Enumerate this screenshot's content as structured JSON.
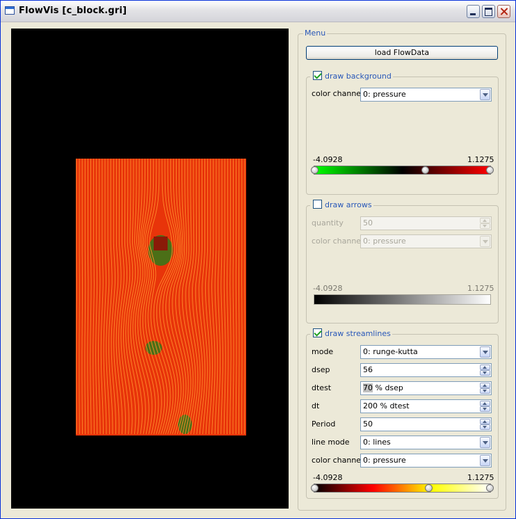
{
  "window": {
    "title": "FlowVis [c_block.gri]"
  },
  "menu": {
    "title": "Menu",
    "load_button": "load FlowData",
    "background": {
      "title": "draw background",
      "checked": true,
      "color_channel_label": "color channel",
      "color_channel_value": "0: pressure",
      "min": "-4.0928",
      "max": "1.1275",
      "colors": [
        "#00ff00",
        "#000000",
        "#ff0000"
      ],
      "knob_fractions": [
        0.0,
        0.63,
        1.0
      ]
    },
    "arrows": {
      "title": "draw arrows",
      "checked": false,
      "quantity_label": "quantity",
      "quantity_value": "50",
      "color_channel_label": "color channel",
      "color_channel_value": "0: pressure",
      "min": "-4.0928",
      "max": "1.1275",
      "colors": [
        "#000000",
        "#ffffff"
      ]
    },
    "streamlines": {
      "title": "draw streamlines",
      "checked": true,
      "mode_label": "mode",
      "mode_value": "0: runge-kutta",
      "dsep_label": "dsep",
      "dsep_value": "56",
      "dtest_label": "dtest",
      "dtest_value_selected": "70",
      "dtest_value_rest": " % dsep",
      "dt_label": "dt",
      "dt_value": "200 % dtest",
      "period_label": "Period",
      "period_value": "50",
      "line_mode_label": "line mode",
      "line_mode_value": "0: lines",
      "color_channel_label": "color channel",
      "color_channel_value": "0: pressure",
      "min": "-4.0928",
      "max": "1.1275",
      "colors": [
        "#000000",
        "#ff0000",
        "#ffff00",
        "#ffffff"
      ],
      "knob_fractions": [
        0.0,
        0.65,
        1.0
      ]
    }
  },
  "view": {
    "background_color": "#000000",
    "field_color": "#e8340a",
    "streamline_color": "#ff8a2a",
    "vortex_color": "#2f7a1a"
  }
}
